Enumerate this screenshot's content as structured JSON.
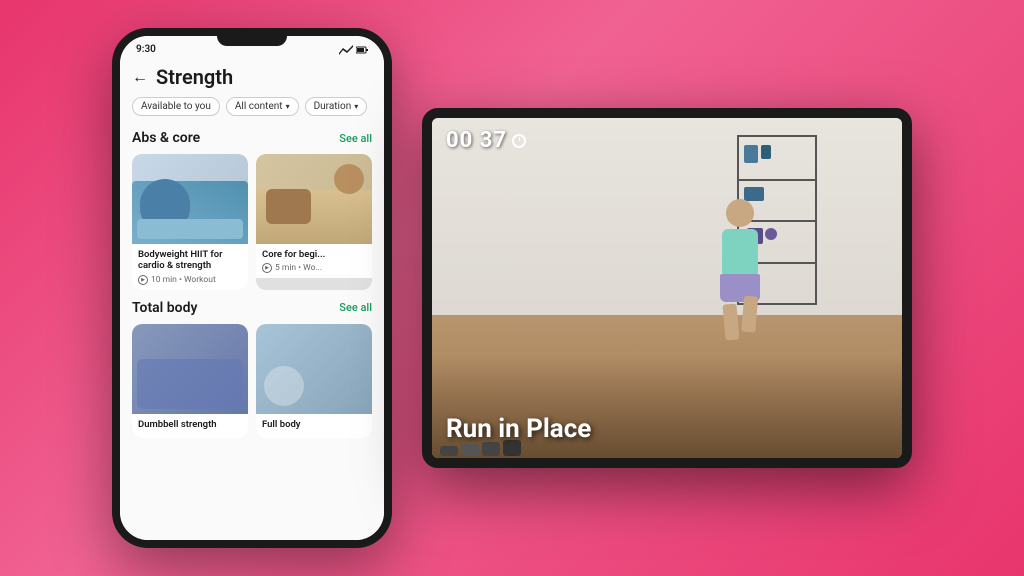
{
  "background": {
    "gradient_start": "#e8356d",
    "gradient_end": "#f06292"
  },
  "phone": {
    "status_bar": {
      "time": "9:30",
      "signal_icon": "▼◀",
      "battery_icon": "▮▮"
    },
    "header": {
      "back_label": "←",
      "title": "Strength"
    },
    "filters": [
      {
        "label": "Available to you"
      },
      {
        "label": "All content",
        "has_chevron": true
      },
      {
        "label": "Duration",
        "has_chevron": true
      }
    ],
    "sections": [
      {
        "title": "Abs & core",
        "see_all_label": "See all",
        "cards": [
          {
            "title": "Bodyweight HIIT for cardio & strength",
            "meta": "10 min • Workout"
          },
          {
            "title": "Core for begi...",
            "meta": "5 min • Wo..."
          }
        ]
      },
      {
        "title": "Total body",
        "see_all_label": "See all",
        "cards": []
      }
    ]
  },
  "tablet": {
    "timer": "00 37",
    "timer_icon_label": "timer-icon",
    "exercise_name": "Run in Place"
  }
}
